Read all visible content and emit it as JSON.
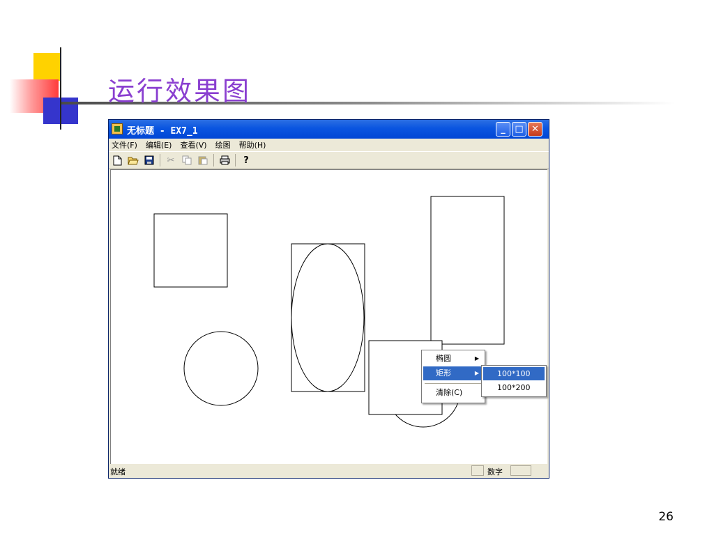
{
  "slide": {
    "title": "运行效果图",
    "page_number": "26"
  },
  "window": {
    "title": "无标题 - EX7_1",
    "controls": [
      "minimize",
      "maximize",
      "close"
    ]
  },
  "menubar": {
    "items": [
      "文件(F)",
      "编辑(E)",
      "查看(V)",
      "绘图",
      "帮助(H)"
    ]
  },
  "toolbar": {
    "icons": [
      "new-file-icon",
      "open-folder-icon",
      "save-icon",
      "cut-icon",
      "copy-icon",
      "paste-icon",
      "print-icon",
      "help-icon"
    ]
  },
  "context_menu": {
    "items": [
      "椭圆",
      "矩形",
      "清除(C)"
    ],
    "highlighted": "矩形",
    "submenu": {
      "items": [
        "100*100",
        "100*200"
      ],
      "highlighted": "100*100"
    }
  },
  "statusbar": {
    "text": "就绪",
    "num_indicator": "数字"
  }
}
